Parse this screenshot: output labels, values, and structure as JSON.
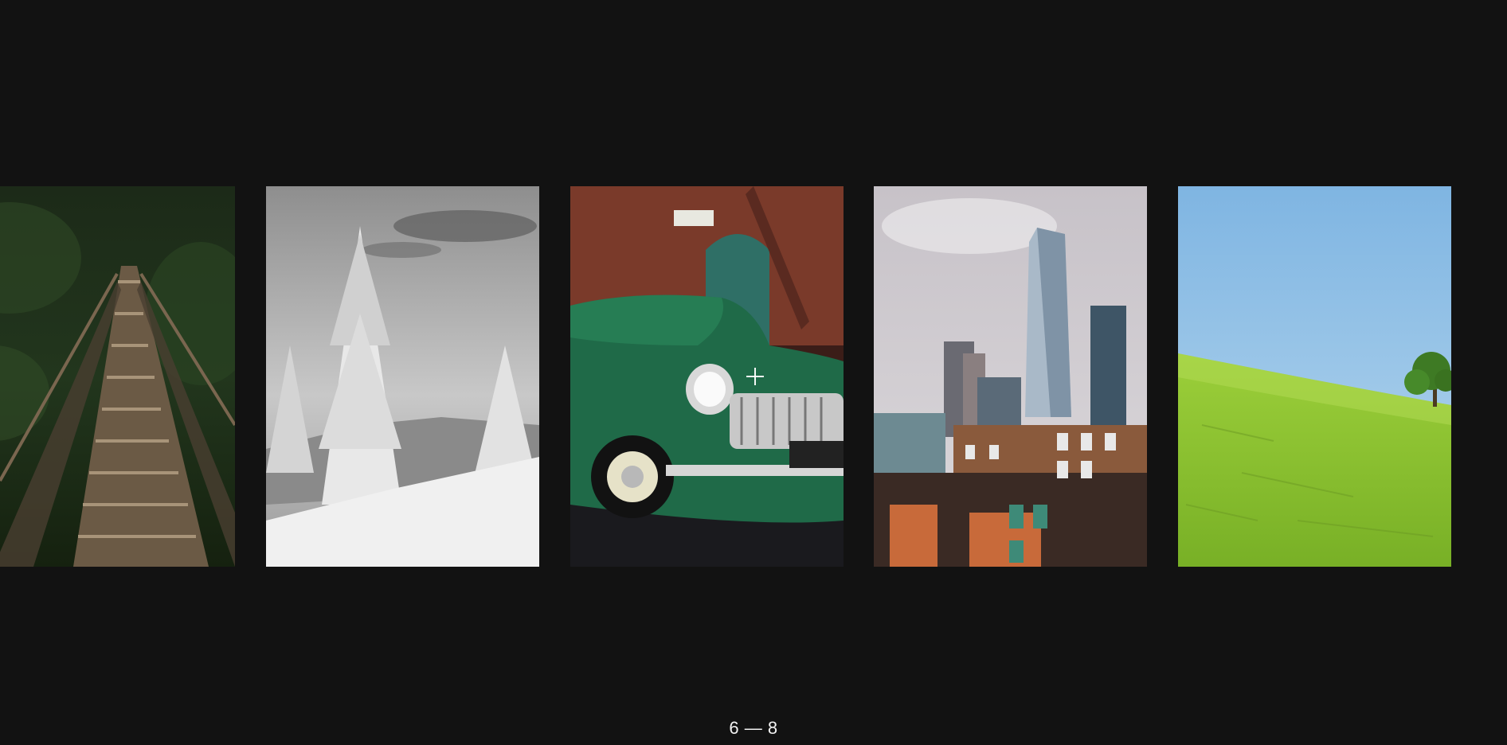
{
  "gallery": {
    "counter": "6 — 8",
    "slides": [
      {
        "icon": "bridge-photo"
      },
      {
        "icon": "snowy-forest-photo"
      },
      {
        "icon": "green-car-photo"
      },
      {
        "icon": "city-skyline-photo"
      },
      {
        "icon": "green-hill-photo"
      }
    ]
  }
}
